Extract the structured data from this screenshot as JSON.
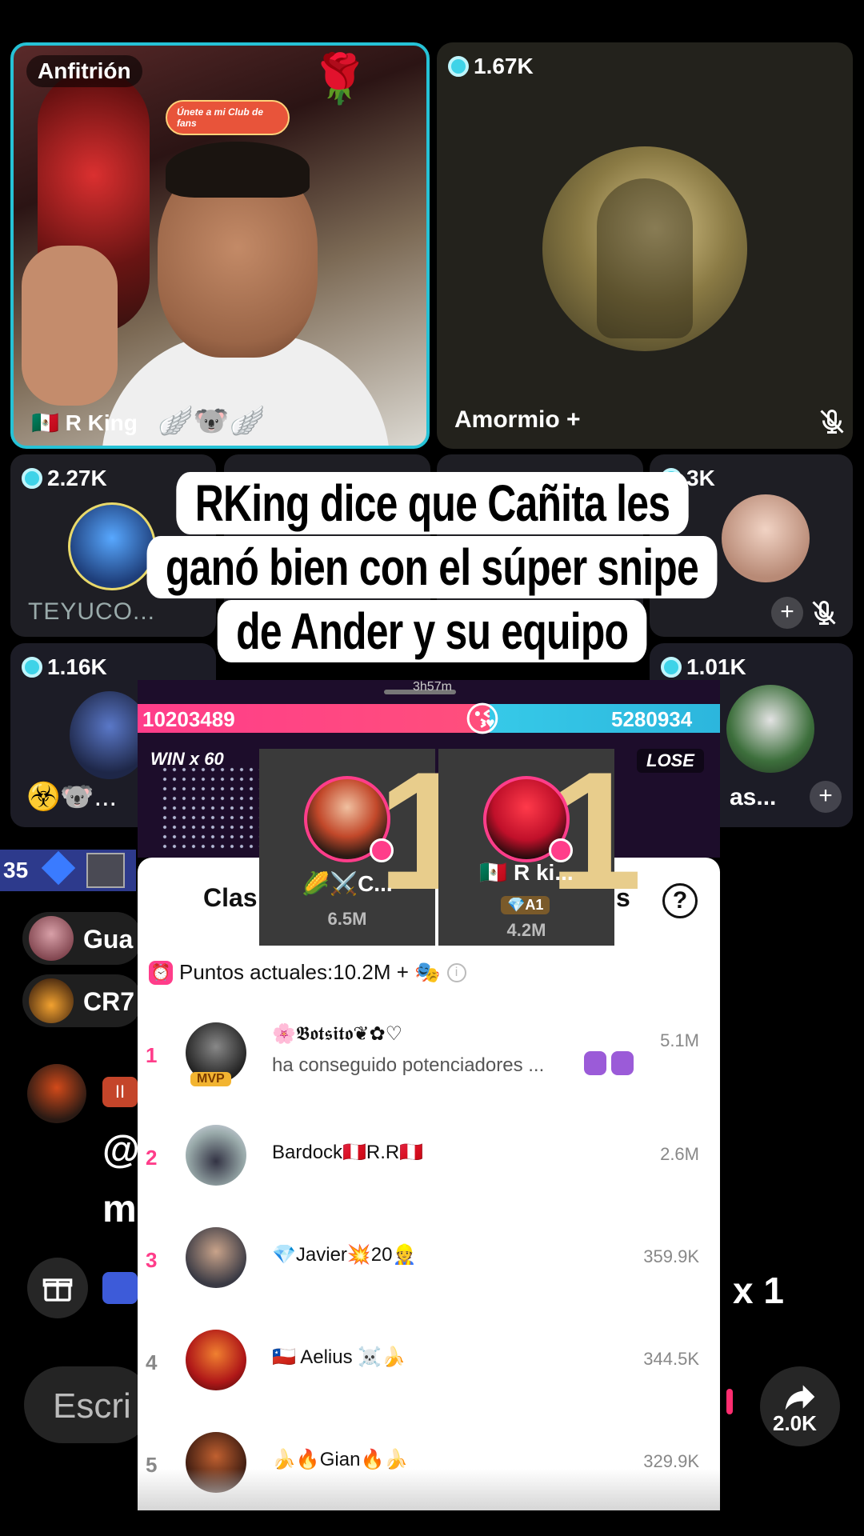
{
  "host_tile": {
    "badge": "Anfitrión",
    "club_text": "Únete a mi Club de fans",
    "name": "🇲🇽 R King",
    "emojis": "🪽🐨🪽"
  },
  "guest_tile": {
    "score": "1.67K",
    "name": "Amormio",
    "plus": "+"
  },
  "row2": {
    "a_score": "2.27K",
    "a_name": "TEYUCO...",
    "d_score": "3K",
    "d_plus": "+"
  },
  "row3": {
    "a_score": "1.16K",
    "a_emojis": "☣️🐨...",
    "d_score": "1.01K",
    "d_name": "as...",
    "d_plus": "+"
  },
  "caption": {
    "line1": "RKing dice que Cañita les",
    "line2": "ganó bien con el súper snipe",
    "line3": "de Ander y su equipo"
  },
  "behind_chat": {
    "level": "35",
    "user1": "Gua",
    "user2": "CR7",
    "badge": "II",
    "mention": "@",
    "text": "m",
    "input_placeholder": "Escri",
    "combo": "x 1",
    "share_count": "2.0K"
  },
  "battle": {
    "timer": "3h57m",
    "left_score": "10203489",
    "right_score": "5280934",
    "center_emoji": "😘",
    "win_label": "WIN x 60",
    "lose_label": "LOSE",
    "cards": [
      {
        "rank": "1",
        "name": "🌽⚔️C...",
        "score": "6.5M"
      },
      {
        "rank": "1",
        "name": "🇲🇽 R ki...",
        "badge": "💎A1",
        "score": "4.2M"
      }
    ]
  },
  "ranking": {
    "title_left": "Clas",
    "title_right": "s",
    "help": "?",
    "points_label": "Puntos actuales:10.2M + 🎭",
    "info": "i",
    "rows": [
      {
        "rank": "1",
        "name": "🌸𝕭𝖔𝖙𝖘𝖎𝖙𝖔❦✿♡",
        "sub": "ha conseguido potenciadores ...",
        "points": "5.1M",
        "mvp": "MVP"
      },
      {
        "rank": "2",
        "name": "Bardock🇵🇪R.R🇵🇪",
        "points": "2.6M"
      },
      {
        "rank": "3",
        "name": "💎Javier💥20👷",
        "points": "359.9K"
      },
      {
        "rank": "4",
        "name": "🇨🇱 Aelius ☠️🍌",
        "points": "344.5K"
      },
      {
        "rank": "5",
        "name": "🍌🔥Gian🔥🍌",
        "points": "329.9K"
      }
    ]
  },
  "colors": {
    "accent_teal": "#26c2d6",
    "battle_pink": "#ff3d8a",
    "battle_blue": "#36c9e8",
    "gold": "#e8cd8c"
  }
}
